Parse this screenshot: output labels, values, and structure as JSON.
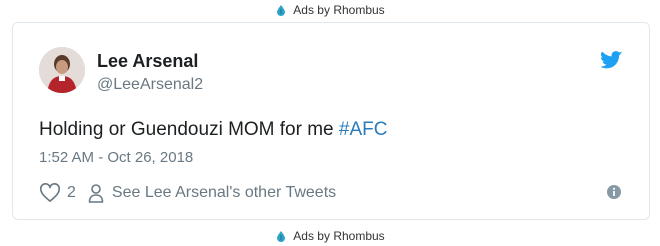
{
  "ads": {
    "top_label": "Ads by Rhombus",
    "bottom_label": "Ads by Rhombus",
    "icon": "rhombus-drop-icon"
  },
  "tweet": {
    "author_name": "Lee Arsenal",
    "author_handle": "@LeeArsenal2",
    "text": "Holding or Guendouzi MOM for me",
    "hashtag": "#AFC",
    "timestamp": "1:52 AM - Oct 26, 2018",
    "like_count": "2",
    "profile_link": "See Lee Arsenal's other Tweets"
  },
  "icons": {
    "brand": "twitter-bird-icon",
    "like": "heart-icon",
    "profile": "person-icon",
    "info": "info-icon"
  },
  "colors": {
    "twitter_blue": "#1da1f2",
    "hashtag": "#2b7bb9",
    "muted_text": "#697882",
    "card_border": "#e1e8ed"
  }
}
